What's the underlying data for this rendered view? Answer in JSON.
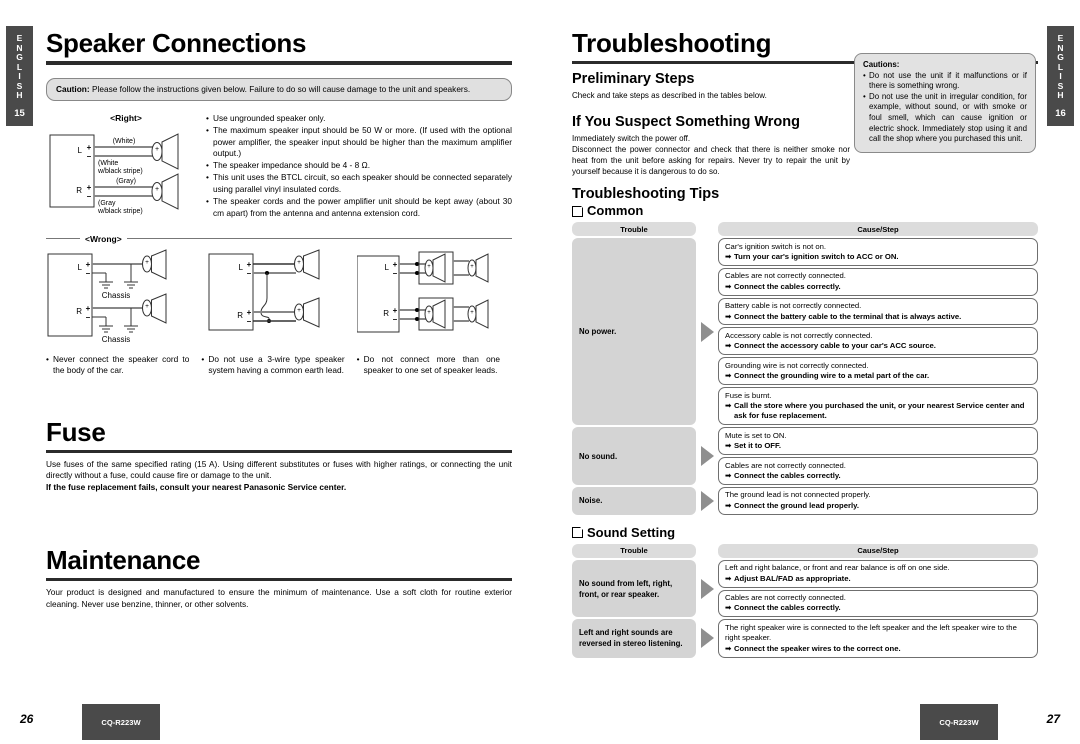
{
  "tabs": {
    "left": {
      "letters": [
        "E",
        "N",
        "G",
        "L",
        "I",
        "S",
        "H"
      ],
      "page": "15"
    },
    "right": {
      "letters": [
        "E",
        "N",
        "G",
        "L",
        "I",
        "S",
        "H"
      ],
      "page": "16"
    }
  },
  "left_page": {
    "title": "Speaker Connections",
    "caution_label": "Caution:",
    "caution_text": " Please follow the instructions given below.  Failure to do so will cause damage to the unit and speakers.",
    "right_diagram": {
      "label": "<Right>",
      "terminals": [
        "L",
        "R"
      ],
      "wire_labels": [
        "(White)",
        "(White\nw/black stripe)",
        "(Gray)",
        "(Gray\nw/black stripe)"
      ],
      "white": "(White)",
      "white_stripe_1": "(White",
      "white_stripe_2": "w/black stripe)",
      "gray": "(Gray)",
      "gray_stripe_1": "(Gray",
      "gray_stripe_2": "w/black stripe)"
    },
    "bullets": [
      "Use ungrounded speaker only.",
      "The maximum speaker input should be 50 W or more.  (If used with the optional power amplifier, the speaker input should be higher than the maximum amplifier output.)",
      "The speaker impedance should be 4 - 8 Ω.",
      "This unit uses the BTCL circuit, so each speaker should be connected separately using parallel vinyl insulated cords.",
      "The speaker cords and the power amplifier unit should be kept away (about 30 cm apart) from the antenna and antenna extension cord."
    ],
    "wrong_label": "<Wrong>",
    "wrong_chassis_label": "Chassis",
    "wrong_terminals": [
      "L",
      "R"
    ],
    "wrong_captions": [
      "Never connect the speaker cord to the body of the car.",
      "Do not use a 3-wire type speaker system having a common earth lead.",
      "Do not connect more than one speaker to one set of speaker leads."
    ],
    "fuse": {
      "title": "Fuse",
      "body": "Use fuses of the same specified rating (15 A). Using different substitutes or fuses with higher ratings, or connecting the unit directly without a fuse, could cause fire or damage to the unit.",
      "bold": "If the fuse replacement fails, consult your nearest Panasonic Service center."
    },
    "maintenance": {
      "title": "Maintenance",
      "body": "Your product is designed and manufactured to ensure the minimum of maintenance. Use a soft cloth for routine exterior cleaning. Never use benzine, thinner, or other solvents."
    },
    "page_number": "26",
    "model": "CQ-R223W"
  },
  "right_page": {
    "title": "Troubleshooting",
    "preliminary": {
      "heading": "Preliminary Steps",
      "body": "Check and take steps as described in the tables below."
    },
    "suspect": {
      "heading": "If You Suspect Something Wrong",
      "body1": "Immediately switch the power off.",
      "body2": "Disconnect the power connector and check that there is neither smoke nor heat from the unit before asking for repairs. Never try to repair the unit by yourself because it is dangerous to do so."
    },
    "cautions": {
      "heading": "Cautions:",
      "items": [
        "Do not use the unit if it malfunctions or if there is something wrong.",
        "Do not use the unit in irregular condition, for example, without sound, or with smoke or foul smell, which can cause ignition or electric shock. Immediately stop using it and call the shop where you purchased this unit."
      ]
    },
    "tips_heading": "Troubleshooting Tips",
    "arrow_glyph": "➡",
    "groups": [
      {
        "name": "Common",
        "col_trouble": "Trouble",
        "col_cause": "Cause/Step",
        "rows": [
          {
            "trouble": "No power.",
            "items": [
              {
                "cause": "Car's ignition switch is not on.",
                "step": "Turn your car's ignition switch to ACC or ON."
              },
              {
                "cause": "Cables are not correctly connected.",
                "step": "Connect the cables correctly."
              },
              {
                "cause": "Battery cable is not correctly connected.",
                "step": "Connect the battery cable to the terminal that is always active."
              },
              {
                "cause": "Accessory cable is not correctly connected.",
                "step": "Connect the accessory cable to your car's ACC source."
              },
              {
                "cause": "Grounding wire is not correctly connected.",
                "step": "Connect the grounding wire to a metal part of the car."
              },
              {
                "cause": "Fuse is burnt.",
                "step": "Call the store where you purchased the unit, or your nearest Service center and ask for fuse replacement."
              }
            ]
          },
          {
            "trouble": "No sound.",
            "items": [
              {
                "cause": "Mute is set to ON.",
                "step": "Set it to OFF."
              },
              {
                "cause": "Cables are not correctly connected.",
                "step": "Connect the cables correctly."
              }
            ]
          },
          {
            "trouble": "Noise.",
            "items": [
              {
                "cause": "The ground lead is not connected properly.",
                "step": "Connect the ground lead properly."
              }
            ]
          }
        ]
      },
      {
        "name": "Sound Setting",
        "col_trouble": "Trouble",
        "col_cause": "Cause/Step",
        "rows": [
          {
            "trouble": "No sound from left, right, front, or rear speaker.",
            "items": [
              {
                "cause": "Left and right balance, or front and rear balance is off on one side.",
                "step": "Adjust BAL/FAD as appropriate."
              },
              {
                "cause": "Cables are not correctly connected.",
                "step": "Connect the cables correctly."
              }
            ]
          },
          {
            "trouble": "Left and right sounds are reversed in stereo listening.",
            "items": [
              {
                "cause": "The right speaker wire is connected to the left speaker and the left speaker wire to the right speaker.",
                "step": "Connect the speaker wires to the correct one."
              }
            ]
          }
        ]
      }
    ],
    "page_number": "27",
    "model": "CQ-R223W"
  }
}
